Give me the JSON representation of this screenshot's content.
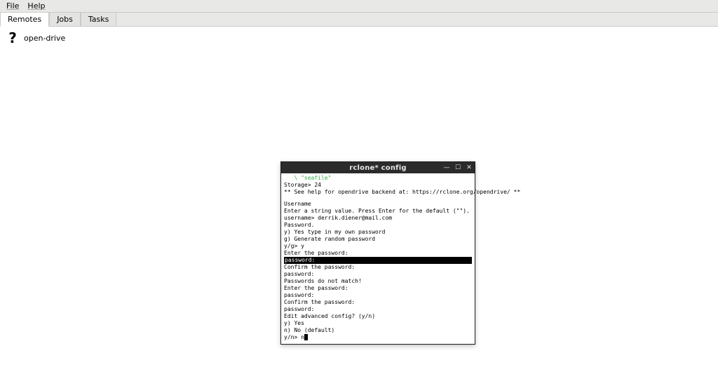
{
  "menubar": {
    "items": [
      "File",
      "Help"
    ]
  },
  "tabs": [
    {
      "label": "Remotes",
      "active": true
    },
    {
      "label": "Jobs",
      "active": false
    },
    {
      "label": "Tasks",
      "active": false
    }
  ],
  "remotes": [
    {
      "icon": "?",
      "label": "open-drive"
    }
  ],
  "terminal": {
    "title": "rclone* config",
    "lines": [
      {
        "text": "   \\ \"seafile\"",
        "class": "green"
      },
      {
        "text": "Storage> 24"
      },
      {
        "text": "** See help for opendrive backend at: https://rclone.org/opendrive/ **"
      },
      {
        "text": ""
      },
      {
        "text": "Username"
      },
      {
        "text": "Enter a string value. Press Enter for the default (\"\")."
      },
      {
        "text": "username> derrik.diener@mail.com"
      },
      {
        "text": "Password."
      },
      {
        "text": "y) Yes type in my own password"
      },
      {
        "text": "g) Generate random password"
      },
      {
        "text": "y/g> y"
      },
      {
        "text": "Enter the password:"
      },
      {
        "text": "password:",
        "hl": true
      },
      {
        "text": "Confirm the password:"
      },
      {
        "text": "password:"
      },
      {
        "text": "Passwords do not match!"
      },
      {
        "text": "Enter the password:"
      },
      {
        "text": "password:"
      },
      {
        "text": "Confirm the password:"
      },
      {
        "text": "password:"
      },
      {
        "text": "Edit advanced config? (y/n)"
      },
      {
        "text": "y) Yes"
      },
      {
        "text": "n) No (default)"
      },
      {
        "text": "y/n> n",
        "cursorAfter": true
      }
    ]
  }
}
